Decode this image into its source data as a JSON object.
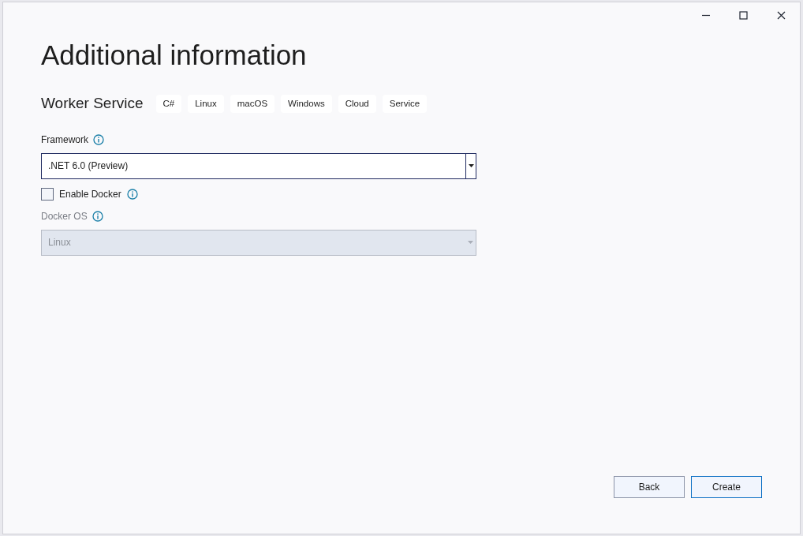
{
  "title": "Additional information",
  "template": {
    "name": "Worker Service",
    "tags": [
      "C#",
      "Linux",
      "macOS",
      "Windows",
      "Cloud",
      "Service"
    ]
  },
  "framework": {
    "label": "Framework",
    "value": ".NET 6.0 (Preview)",
    "disabled": false
  },
  "enable_docker": {
    "label": "Enable Docker",
    "checked": false
  },
  "docker_os": {
    "label": "Docker OS",
    "value": "Linux",
    "disabled": true
  },
  "buttons": [
    {
      "label": "Back",
      "kind": "secondary"
    },
    {
      "label": "Create",
      "kind": "primary"
    }
  ]
}
